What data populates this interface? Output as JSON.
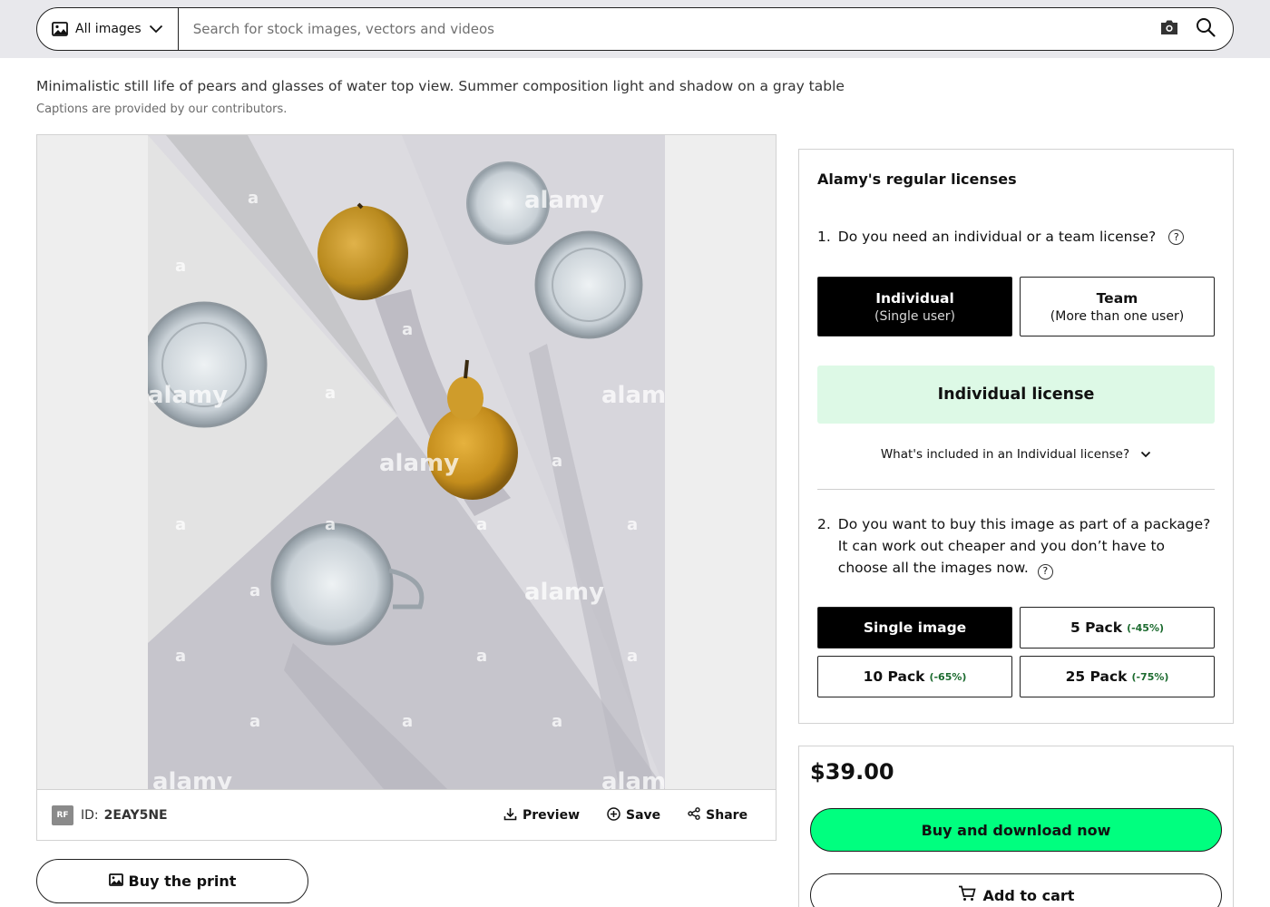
{
  "search": {
    "scope_label": "All images",
    "placeholder": "Search for stock images, vectors and videos"
  },
  "image": {
    "caption": "Minimalistic still life of pears and glasses of water top view. Summer composition light and shadow on a gray table",
    "caption_note": "Captions are provided by our contributors.",
    "watermark": "alamy",
    "watermark_small": "a",
    "license_badge": "RF",
    "id_label": "ID:",
    "id_value": "2EAY5NE",
    "actions": {
      "preview": "Preview",
      "save": "Save",
      "share": "Share"
    },
    "buy_print": "Buy the print"
  },
  "license": {
    "title": "Alamy's regular licenses",
    "q1_num": "1.",
    "q1_text": "Do you need an individual or a team license?",
    "help_glyph": "?",
    "individual_label": "Individual",
    "individual_sub": "(Single user)",
    "team_label": "Team",
    "team_sub": "(More than one user)",
    "selected_banner": "Individual license",
    "included_text": "What's included in an Individual license?",
    "q2_num": "2.",
    "q2_text": "Do you want to buy this image as part of a package? It can work out cheaper and you don’t have to choose all the images now.",
    "packages": [
      {
        "label": "Single image",
        "discount": ""
      },
      {
        "label": "5 Pack",
        "discount": "(-45%)"
      },
      {
        "label": "10 Pack",
        "discount": "(-65%)"
      },
      {
        "label": "25 Pack",
        "discount": "(-75%)"
      }
    ]
  },
  "purchase": {
    "price": "$39.00",
    "buy_now": "Buy and download now",
    "add_to_cart": "Add to cart"
  },
  "colors": {
    "buy_now_bg": "#00ff7f",
    "banner_bg": "#ddf9e6",
    "discount_text": "#1c6b2f",
    "top_band": "#e8e8ec"
  }
}
